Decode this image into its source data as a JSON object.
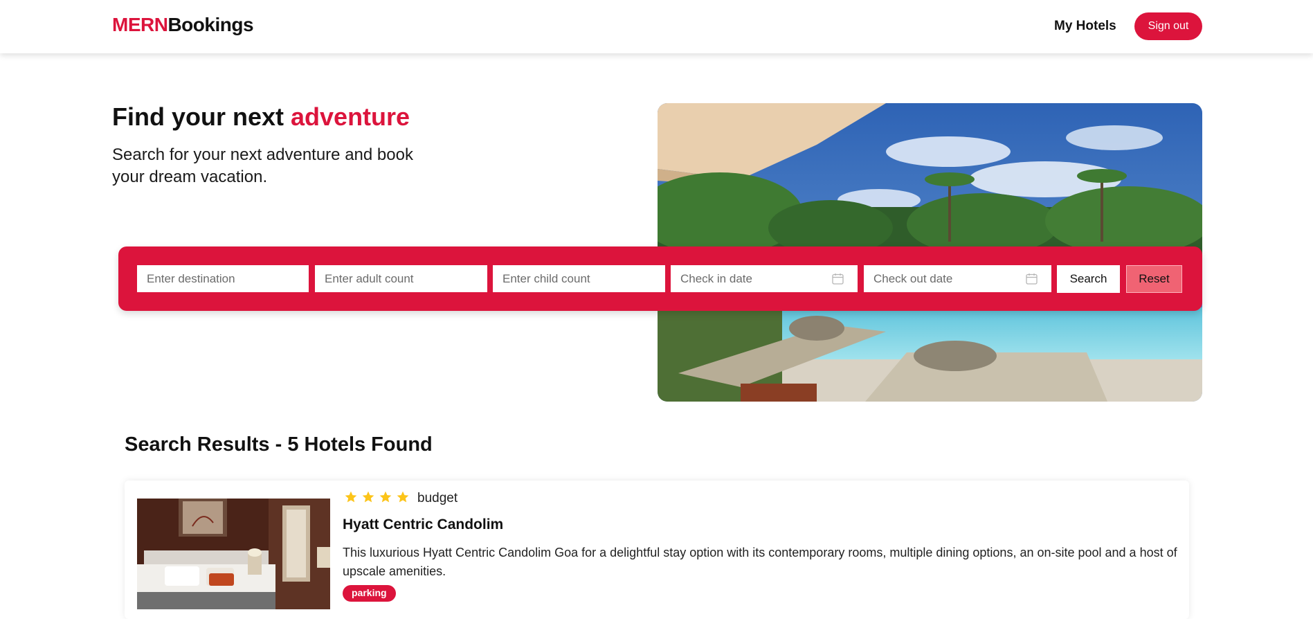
{
  "header": {
    "logo_brand": "MERN",
    "logo_rest": "Bookings",
    "nav_my_hotels": "My Hotels",
    "sign_out_label": "Sign out"
  },
  "hero": {
    "title_prefix": "Find your next ",
    "title_accent": "adventure",
    "subtitle": "Search for your next adventure and book your dream vacation."
  },
  "search": {
    "destination_placeholder": "Enter destination",
    "adult_placeholder": "Enter adult count",
    "child_placeholder": "Enter child count",
    "checkin_placeholder": "Check in date",
    "checkout_placeholder": "Check out date",
    "search_label": "Search",
    "reset_label": "Reset"
  },
  "results": {
    "title": "Search Results - 5 Hotels Found",
    "hotels": [
      {
        "star_rating": 4,
        "type": "budget",
        "name": "Hyatt Centric Candolim",
        "description": "This luxurious Hyatt Centric Candolim Goa for a delightful stay option with its contemporary rooms, multiple dining options, an on-site pool and a host of upscale amenities.",
        "facilities": [
          "parking"
        ]
      }
    ]
  },
  "colors": {
    "accent": "#dc143c",
    "reset_button": "#f06373",
    "star": "#fcc419"
  },
  "icons": [
    "calendar-icon",
    "star-icon"
  ]
}
